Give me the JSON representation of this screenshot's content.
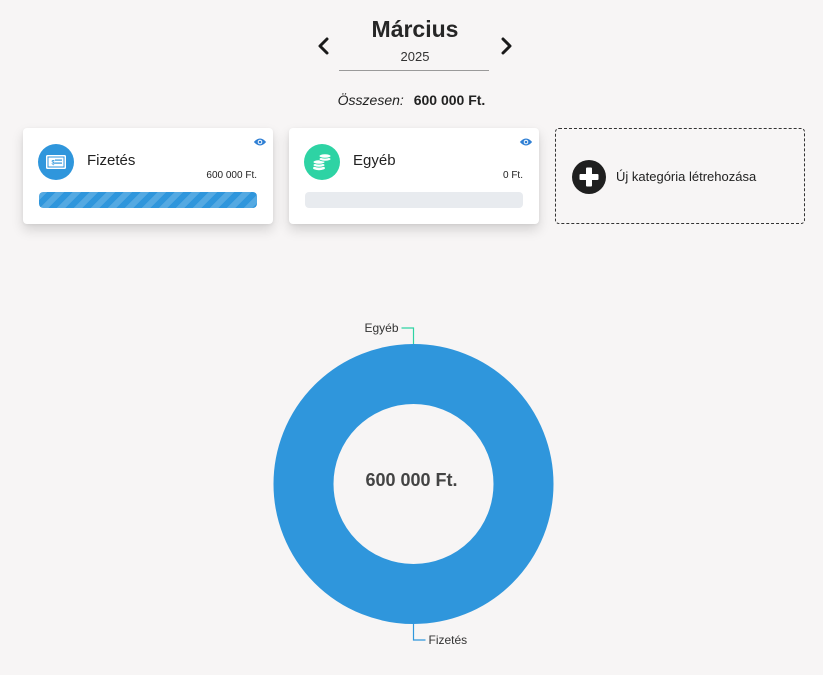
{
  "header": {
    "month": "Március",
    "year": "2025",
    "prev_icon": "chevron-left-icon",
    "next_icon": "chevron-right-icon"
  },
  "summary": {
    "label": "Összesen:",
    "value": "600 000 Ft."
  },
  "categories": [
    {
      "name": "Fizetés",
      "amount": "600 000 Ft.",
      "icon": "cheque-icon",
      "color": "#2f96dc",
      "progress": 1.0
    },
    {
      "name": "Egyéb",
      "amount": "0 Ft.",
      "icon": "coins-icon",
      "color": "#2ed3a4",
      "progress": 0.0
    }
  ],
  "new_category": {
    "label": "Új kategória létrehozása",
    "icon": "plus-circle-icon"
  },
  "chart_data": {
    "type": "pie",
    "center_label": "600 000 Ft.",
    "categories": [
      "Fizetés",
      "Egyéb"
    ],
    "values": [
      600000,
      0
    ],
    "colors": [
      "#2f96dc",
      "#2ed3a4"
    ]
  }
}
